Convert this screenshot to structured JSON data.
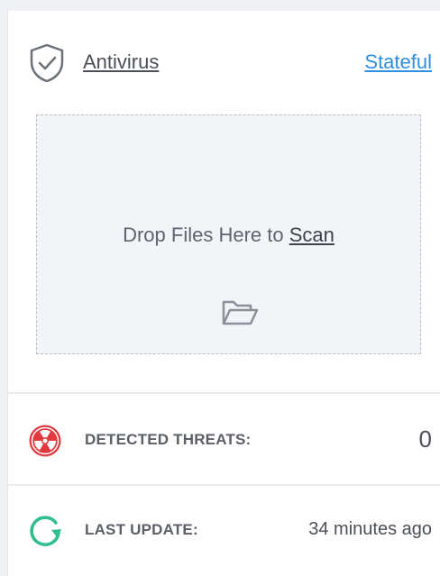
{
  "header": {
    "title": "Antivirus",
    "mode": "Stateful",
    "icon": "shield-check-icon"
  },
  "dropzone": {
    "text": "Drop Files Here to",
    "link": "Scan",
    "icon": "folder-open-icon"
  },
  "stats": {
    "threats": {
      "label": "DETECTED THREATS:",
      "value": "0",
      "icon": "radiation-icon",
      "color": "#e0393e"
    },
    "update": {
      "label": "LAST UPDATE:",
      "value": "34 minutes ago",
      "icon": "refresh-icon",
      "color": "#2fbf8a"
    }
  }
}
